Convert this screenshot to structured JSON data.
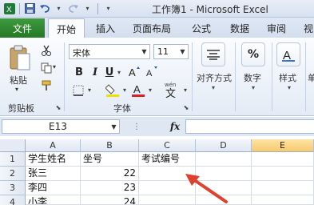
{
  "titlebar": {
    "title": "工作簿1 - Microsoft Excel",
    "qat": [
      "save-icon",
      "undo-icon",
      "redo-icon",
      "customize-icon"
    ]
  },
  "tabs": [
    {
      "label": "文件"
    },
    {
      "label": "开始"
    },
    {
      "label": "插入"
    },
    {
      "label": "页面布局"
    },
    {
      "label": "公式"
    },
    {
      "label": "数据"
    },
    {
      "label": "审阅"
    },
    {
      "label": "视"
    }
  ],
  "ribbon": {
    "clipboard": {
      "paste_label": "粘贴",
      "group_label": "剪贴板"
    },
    "font": {
      "font_name": "宋体",
      "font_size": "11",
      "group_label": "字体"
    },
    "alignment": {
      "label": "对齐方式"
    },
    "number": {
      "label": "数字"
    },
    "styles": {
      "label": "样式"
    },
    "partial_label": "单"
  },
  "formula_bar": {
    "name_box": "E13",
    "fx": "fx",
    "value": ""
  },
  "sheet": {
    "columns": [
      "A",
      "B",
      "C",
      "D",
      "E"
    ],
    "selected_column": "E",
    "rows": [
      "1",
      "2",
      "3",
      "4"
    ],
    "cells": {
      "A1": "学生姓名",
      "B1": "坐号",
      "C1": "考试编号",
      "A2": "张三",
      "B2": "22",
      "A3": "李四",
      "B3": "23",
      "A4": "小李",
      "B4": "24"
    }
  },
  "colors": {
    "file_tab": "#2f8a2f",
    "selected_header": "#f7c96b",
    "arrow": "#e0412f"
  }
}
